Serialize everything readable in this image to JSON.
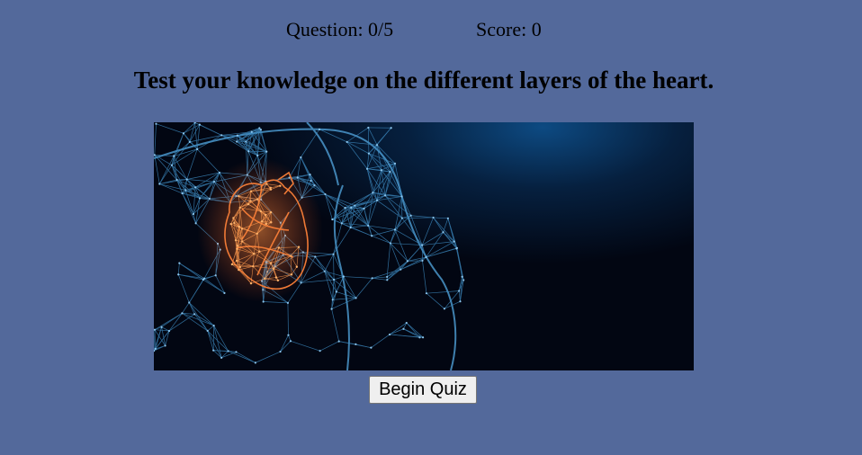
{
  "status": {
    "question": "Question: 0/5",
    "score": "Score: 0"
  },
  "title": "Test your knowledge on the different layers of the heart.",
  "hero_image": {
    "description_icon": "heart-anatomy-wireframe",
    "colors": {
      "background": "#020612",
      "mesh": "#3f8fc7",
      "heart": "#e2642c"
    }
  },
  "begin_button": {
    "label": "Begin Quiz"
  }
}
